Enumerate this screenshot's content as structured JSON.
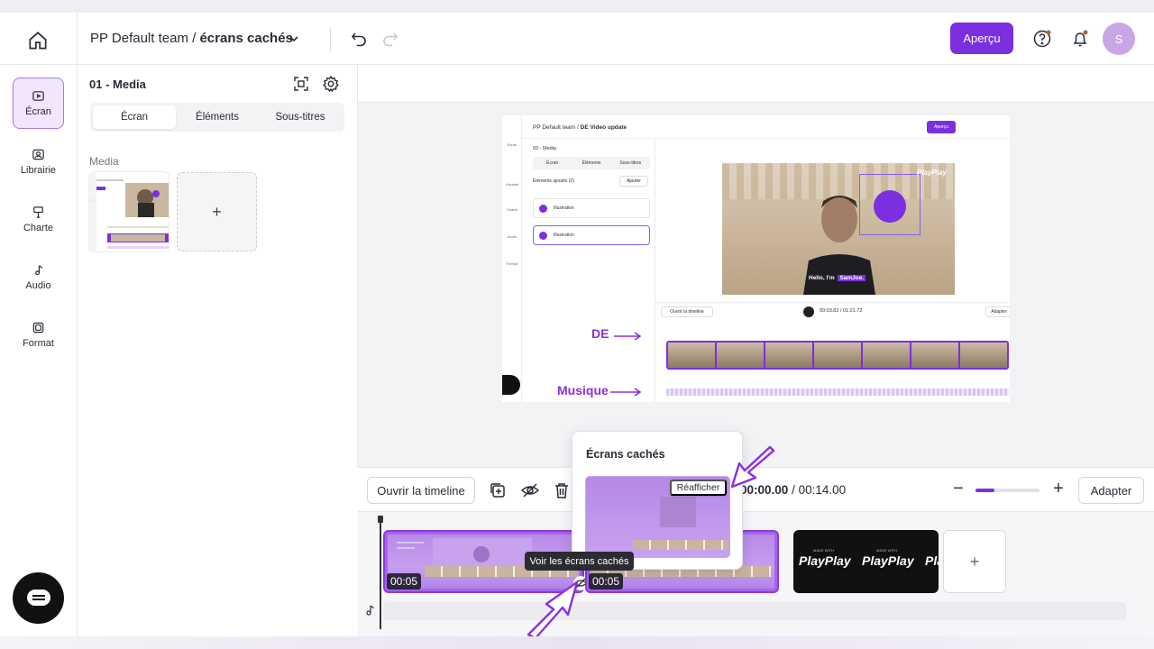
{
  "header": {
    "team": "PP Default team /",
    "project": "écrans cachés",
    "preview_button": "Aperçu",
    "avatar_initial": "S"
  },
  "sidebar": {
    "items": [
      {
        "label": "Écran",
        "icon": "screen-icon",
        "active": true
      },
      {
        "label": "Librairie",
        "icon": "library-icon"
      },
      {
        "label": "Charte",
        "icon": "brand-icon"
      },
      {
        "label": "Audio",
        "icon": "music-note-icon"
      },
      {
        "label": "Format",
        "icon": "format-icon"
      }
    ]
  },
  "panel": {
    "title": "01 - Media",
    "tabs": [
      "Écran",
      "Éléments",
      "Sous-titres"
    ],
    "media_label": "Media",
    "add_label": "+"
  },
  "preview": {
    "crumb_team": "PP Default team /",
    "crumb_project": "DE Video update",
    "apercu": "Aperçu",
    "panel_title": "03 - Media",
    "tabs": [
      "Écran",
      "Éléments",
      "Sous-titres"
    ],
    "added": "Éléments ajoutés (2)",
    "ajouter": "Ajouter",
    "cards": [
      "Illustration",
      "Illustration"
    ],
    "rail": [
      "Écran",
      "Librairie",
      "Charte",
      "Audio",
      "Format"
    ],
    "open_tl": "Ouvrir la timeline",
    "time": "00:03.82 / 01:21.72",
    "adapter": "Adapter",
    "subtitle_a": "Hello, I'm",
    "subtitle_b": "SamJoe.",
    "logo": "PlayPlay",
    "label_de": "DE",
    "label_musique": "Musique"
  },
  "timeline": {
    "open_button": "Ouvrir la timeline",
    "current_time": "00:00.00",
    "total_time": "/ 00:14.00",
    "zoom_level": 0.3,
    "adapter_button": "Adapter",
    "clip1_duration": "00:05",
    "clip2_duration": "00:05",
    "outro_logo": "PlayPlay",
    "outro_small": "MADE WITH",
    "add_clip": "+"
  },
  "popover": {
    "title": "Écrans cachés",
    "restore_button": "Réafficher"
  },
  "tooltip": {
    "text": "Voir les écrans cachés"
  },
  "colors": {
    "accent": "#7b2fe0",
    "active_bg": "#f1e6fb"
  }
}
